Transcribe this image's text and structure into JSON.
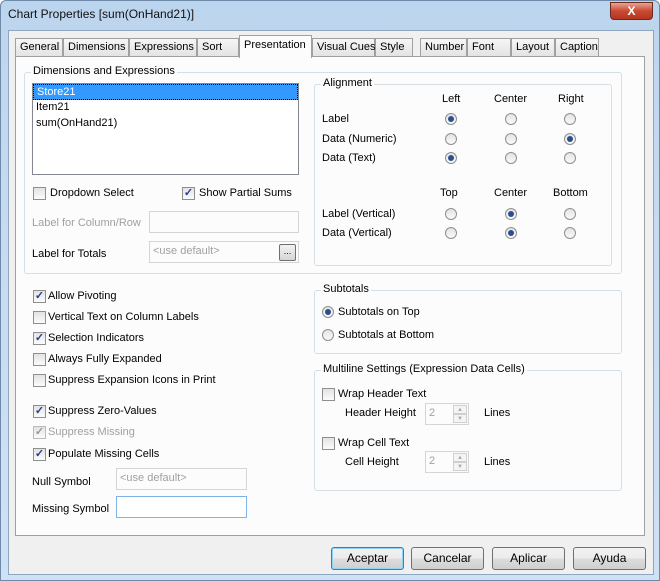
{
  "window": {
    "title": "Chart Properties [sum(OnHand21)]",
    "close": "X"
  },
  "tabs": [
    {
      "label": "General"
    },
    {
      "label": "Dimensions"
    },
    {
      "label": "Expressions"
    },
    {
      "label": "Sort"
    },
    {
      "label": "Presentation",
      "active": true
    },
    {
      "label": "Visual Cues"
    },
    {
      "label": "Style"
    },
    {
      "label": "Number"
    },
    {
      "label": "Font"
    },
    {
      "label": "Layout"
    },
    {
      "label": "Caption"
    }
  ],
  "dimexp": {
    "title": "Dimensions and Expressions",
    "items": [
      "Store21",
      "Item21",
      "sum(OnHand21)"
    ],
    "selected": "Store21",
    "dropdown_select": {
      "label": "Dropdown Select",
      "checked": false
    },
    "show_partial_sums": {
      "label": "Show Partial Sums",
      "checked": true
    },
    "label_col_row": {
      "label": "Label for Column/Row",
      "value": ""
    },
    "label_totals": {
      "label": "Label for Totals",
      "placeholder": "<use default>",
      "button": "..."
    }
  },
  "alignment": {
    "title": "Alignment",
    "h_cols": [
      "Left",
      "Center",
      "Right"
    ],
    "v_cols": [
      "Top",
      "Center",
      "Bottom"
    ],
    "rows": [
      {
        "label": "Label",
        "selected": "Left"
      },
      {
        "label": "Data (Numeric)",
        "selected": "Right"
      },
      {
        "label": "Data (Text)",
        "selected": "Left"
      }
    ],
    "vrows": [
      {
        "label": "Label (Vertical)",
        "selected": "Center"
      },
      {
        "label": "Data (Vertical)",
        "selected": "Center"
      }
    ]
  },
  "options": [
    {
      "label": "Allow Pivoting",
      "checked": true
    },
    {
      "label": "Vertical Text on Column Labels",
      "checked": false
    },
    {
      "label": "Selection Indicators",
      "checked": true
    },
    {
      "label": "Always Fully Expanded",
      "checked": false
    },
    {
      "label": "Suppress Expansion Icons in Print",
      "checked": false
    },
    {
      "label": "Suppress Zero-Values",
      "checked": true
    },
    {
      "label": "Suppress Missing",
      "checked": true,
      "disabled": true
    },
    {
      "label": "Populate Missing Cells",
      "checked": true
    }
  ],
  "null_symbol": {
    "label": "Null Symbol",
    "placeholder": "<use default>"
  },
  "missing_symbol": {
    "label": "Missing Symbol",
    "value": ""
  },
  "subtotals": {
    "title": "Subtotals",
    "on_top": "Subtotals on Top",
    "at_bottom": "Subtotals at Bottom",
    "selected": "on_top"
  },
  "multiline": {
    "title": "Multiline Settings (Expression Data Cells)",
    "wrap_header": {
      "label": "Wrap Header Text",
      "checked": false
    },
    "header_height": {
      "label": "Header Height",
      "value": "2",
      "unit": "Lines"
    },
    "wrap_cell": {
      "label": "Wrap Cell Text",
      "checked": false
    },
    "cell_height": {
      "label": "Cell Height",
      "value": "2",
      "unit": "Lines"
    }
  },
  "buttons": {
    "ok": "Aceptar",
    "cancel": "Cancelar",
    "apply": "Aplicar",
    "help": "Ayuda"
  },
  "check_glyph": "✓"
}
